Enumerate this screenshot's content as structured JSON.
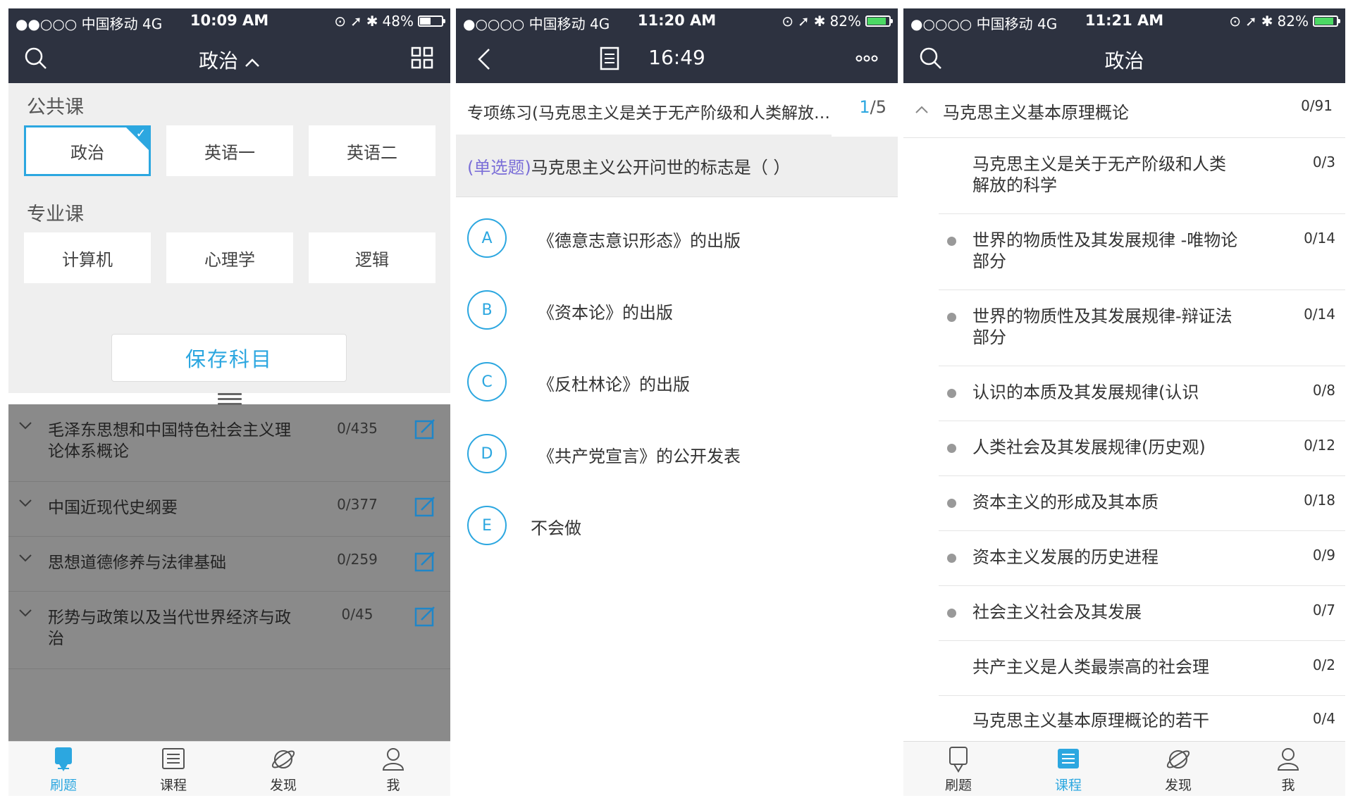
{
  "colors": {
    "navbar": "#2d3240",
    "accent": "#2ca7e0",
    "question_tag": "#7b6fd8",
    "overlay": "#8a8a8a",
    "battery_green": "#4cd964"
  },
  "phone1": {
    "status": {
      "carrier": "●●○○○ 中国移动   4G",
      "time": "10:09 AM",
      "battery": "48%",
      "battery_level": 0.48
    },
    "nav": {
      "title": "政治"
    },
    "public_label": "公共课",
    "public_subjects": [
      {
        "label": "政治",
        "selected": true
      },
      {
        "label": "英语一"
      },
      {
        "label": "英语二"
      }
    ],
    "major_label": "专业课",
    "major_subjects": [
      {
        "label": "计算机"
      },
      {
        "label": "心理学"
      },
      {
        "label": "逻辑"
      }
    ],
    "save_label": "保存科目",
    "courses": [
      {
        "title": "毛泽东思想和中国特色社会主义理论体系概论",
        "count": "0/435"
      },
      {
        "title": "中国近现代史纲要",
        "count": "0/377"
      },
      {
        "title": "思想道德修养与法律基础",
        "count": "0/259"
      },
      {
        "title": "形势与政策以及当代世界经济与政治",
        "count": "0/45"
      }
    ],
    "tabs": [
      {
        "label": "刷题",
        "icon": "pencil-icon",
        "active": true
      },
      {
        "label": "课程",
        "icon": "list-icon"
      },
      {
        "label": "发现",
        "icon": "planet-icon"
      },
      {
        "label": "我",
        "icon": "user-icon"
      }
    ]
  },
  "phone2": {
    "status": {
      "carrier": "●○○○○ 中国移动   4G",
      "time": "11:20 AM",
      "battery": "82%",
      "battery_level": 0.82
    },
    "nav": {
      "title": "16:49"
    },
    "header_title": "专项练习(马克思主义是关于无产阶级和人类解放的科学)",
    "page_current": "1",
    "page_total": "/5",
    "question_tag": "(单选题)",
    "question_text": "马克思主义公开问世的标志是（ ）",
    "options": [
      {
        "letter": "A",
        "text": "《德意志意识形态》的出版"
      },
      {
        "letter": "B",
        "text": "《资本论》的出版"
      },
      {
        "letter": "C",
        "text": "《反杜林论》的出版"
      },
      {
        "letter": "D",
        "text": "《共产党宣言》的公开发表"
      },
      {
        "letter": "E",
        "text": "不会做"
      }
    ]
  },
  "phone3": {
    "status": {
      "carrier": "●○○○○ 中国移动   4G",
      "time": "11:21 AM",
      "battery": "82%",
      "battery_level": 0.82
    },
    "nav": {
      "title": "政治"
    },
    "section": {
      "title": "马克思主义基本原理概论",
      "count": "0/91"
    },
    "chapters": [
      {
        "title": "马克思主义是关于无产阶级和人类解放的科学",
        "count": "0/3",
        "dot": false
      },
      {
        "title": "世界的物质性及其发展规律 -唯物论部分",
        "count": "0/14",
        "dot": true
      },
      {
        "title": "世界的物质性及其发展规律-辩证法部分",
        "count": "0/14",
        "dot": true
      },
      {
        "title": "认识的本质及其发展规律(认识",
        "count": "0/8",
        "dot": true
      },
      {
        "title": "人类社会及其发展规律(历史观)",
        "count": "0/12",
        "dot": true
      },
      {
        "title": "资本主义的形成及其本质",
        "count": "0/18",
        "dot": true
      },
      {
        "title": "资本主义发展的历史进程",
        "count": "0/9",
        "dot": true
      },
      {
        "title": "社会主义社会及其发展",
        "count": "0/7",
        "dot": true
      },
      {
        "title": "共产主义是人类最崇高的社会理",
        "count": "0/2",
        "dot": false
      },
      {
        "title": "马克思主义基本原理概论的若干",
        "count": "0/4",
        "dot": false
      }
    ],
    "tabs": [
      {
        "label": "刷题",
        "icon": "pencil-icon"
      },
      {
        "label": "课程",
        "icon": "list-icon",
        "active": true
      },
      {
        "label": "发现",
        "icon": "planet-icon"
      },
      {
        "label": "我",
        "icon": "user-icon"
      }
    ]
  }
}
